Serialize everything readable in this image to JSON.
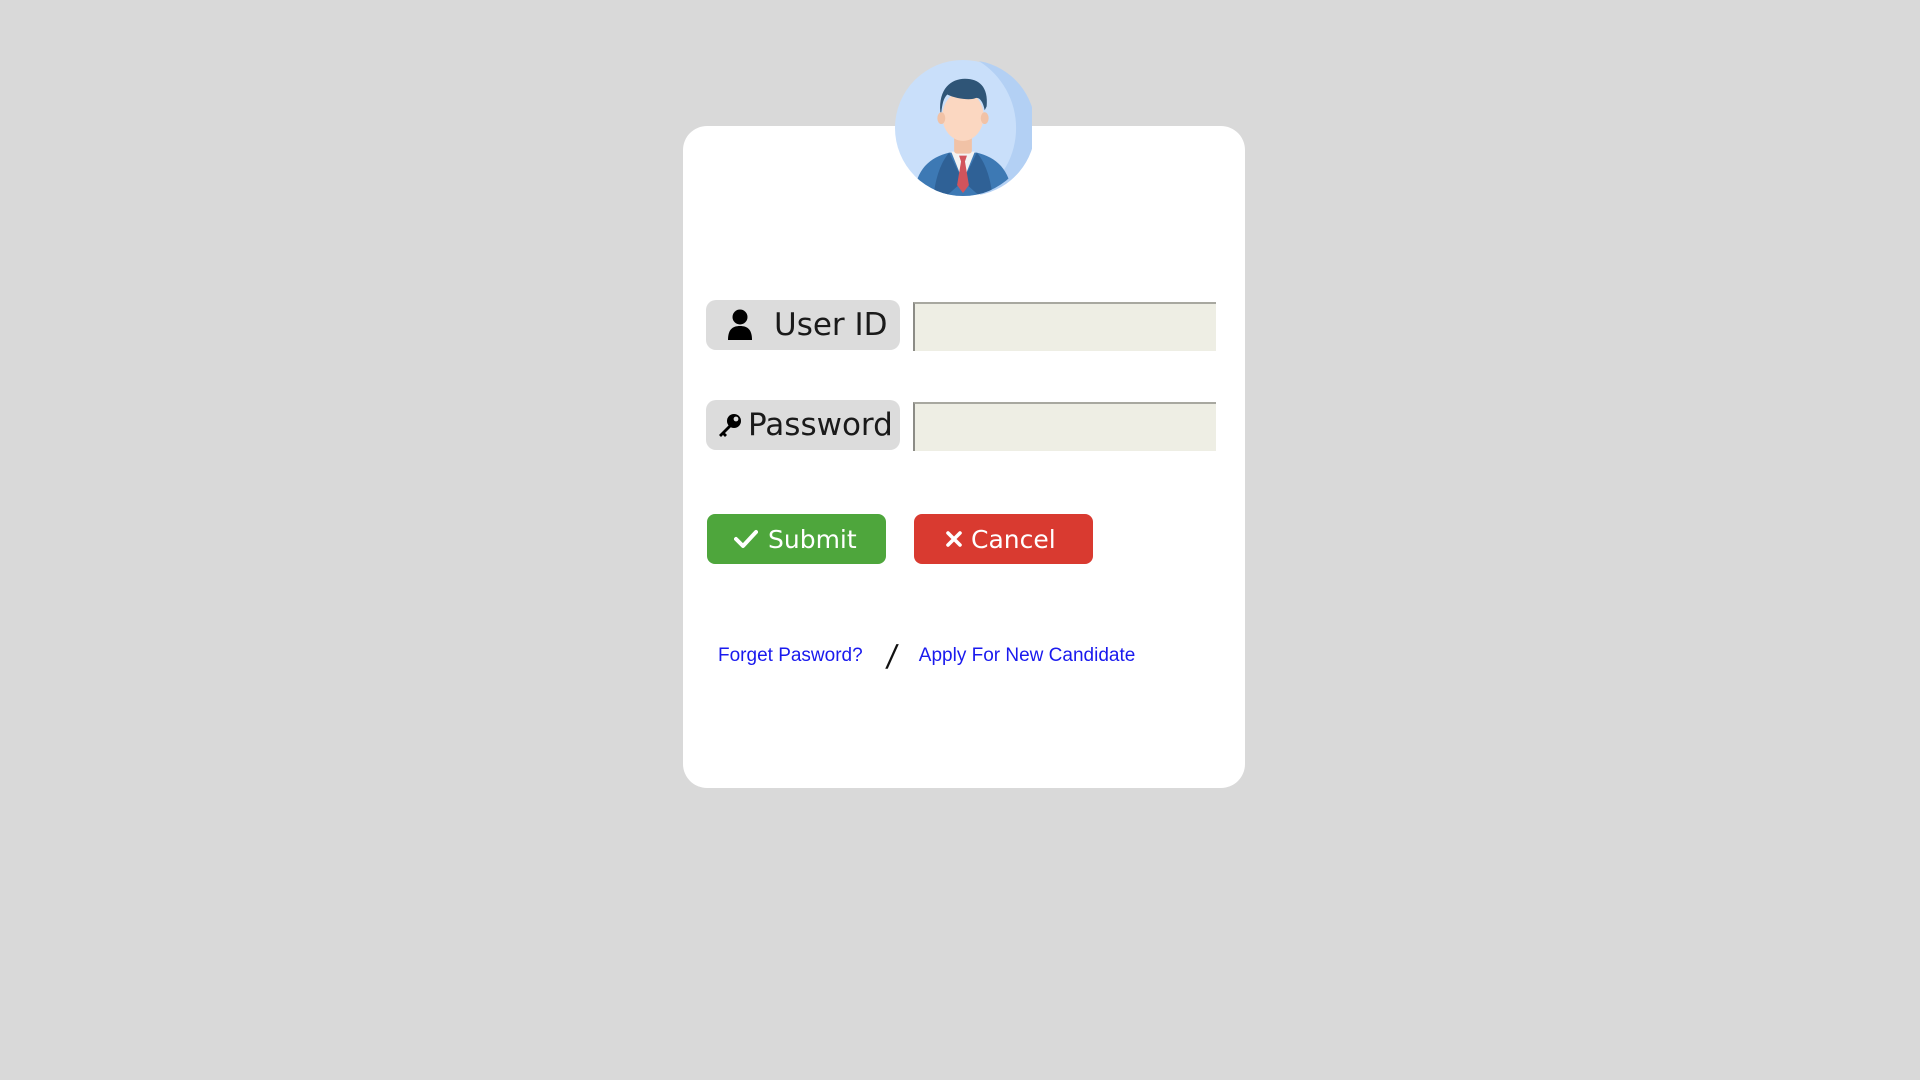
{
  "login_form": {
    "avatar_icon": "businessman-avatar-icon",
    "user_id": {
      "label": "User ID",
      "icon": "user-icon",
      "value": "",
      "placeholder": ""
    },
    "password": {
      "label": "Password",
      "icon": "key-icon",
      "value": "",
      "placeholder": ""
    },
    "submit": {
      "label": "Submit",
      "icon": "check-icon",
      "color": "#4ea63c"
    },
    "cancel": {
      "label": "Cancel",
      "icon": "close-icon",
      "color": "#d93a30"
    },
    "links": {
      "forgot_password": "Forget Pasword?",
      "separator": "/",
      "apply_new": "Apply For New Candidate"
    }
  },
  "colors": {
    "page_background": "#d9d9d9",
    "card_background": "#ffffff",
    "input_background": "#eeeee4",
    "link": "#1a1aee"
  }
}
